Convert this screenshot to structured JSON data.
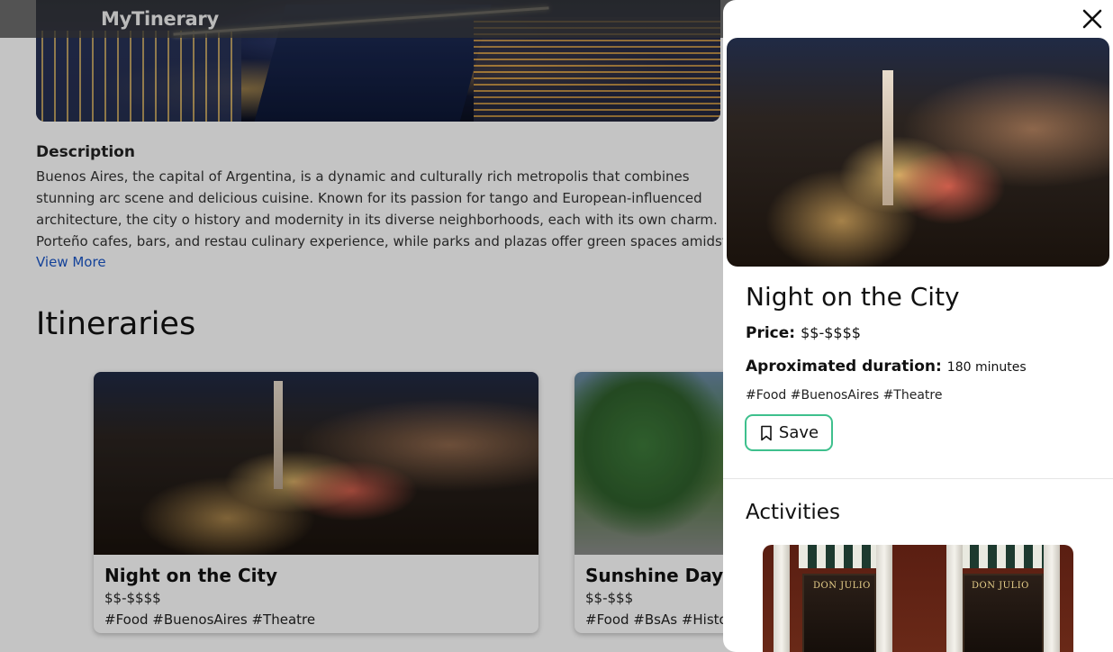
{
  "navbar": {
    "brand": "MyTinerary"
  },
  "city": {
    "description_title": "Description",
    "description": "Buenos Aires, the capital of Argentina, is a dynamic and culturally rich metropolis that combines stunning arc scene and delicious cuisine. Known for its passion for tango and European-influenced architecture, the city o history and modernity in its diverse neighborhoods, each with its own charm. Porteño cafes, bars, and restau culinary experience, while parks and plazas offer green spaces amidst the bustling urban life. Buenos Aires is",
    "view_more": "View More"
  },
  "itineraries": {
    "title": "Itineraries",
    "cards": [
      {
        "title": "Night on the City",
        "price": "$$-$$$$",
        "tags": "#Food #BuenosAires #Theatre"
      },
      {
        "title": "Sunshine Day",
        "price": "$$-$$$",
        "tags": "#Food #BsAs #History"
      }
    ]
  },
  "panel": {
    "title": "Night on the City",
    "price_label": "Price:",
    "price_value": "$$-$$$$",
    "duration_label": "Aproximated duration:",
    "duration_value": "180 minutes",
    "tags": "#Food #BuenosAires #Theatre",
    "save_label": "Save",
    "activities_title": "Activities",
    "activity_sign_left": "DON JULIO",
    "activity_sign_right": "DON JULIO",
    "close_icon": "close-icon",
    "save_icon": "bookmark-icon"
  },
  "colors": {
    "accent_save_border": "#3ec08d",
    "link": "#1a56c8",
    "overlay": "rgba(0,0,0,0.23)"
  }
}
